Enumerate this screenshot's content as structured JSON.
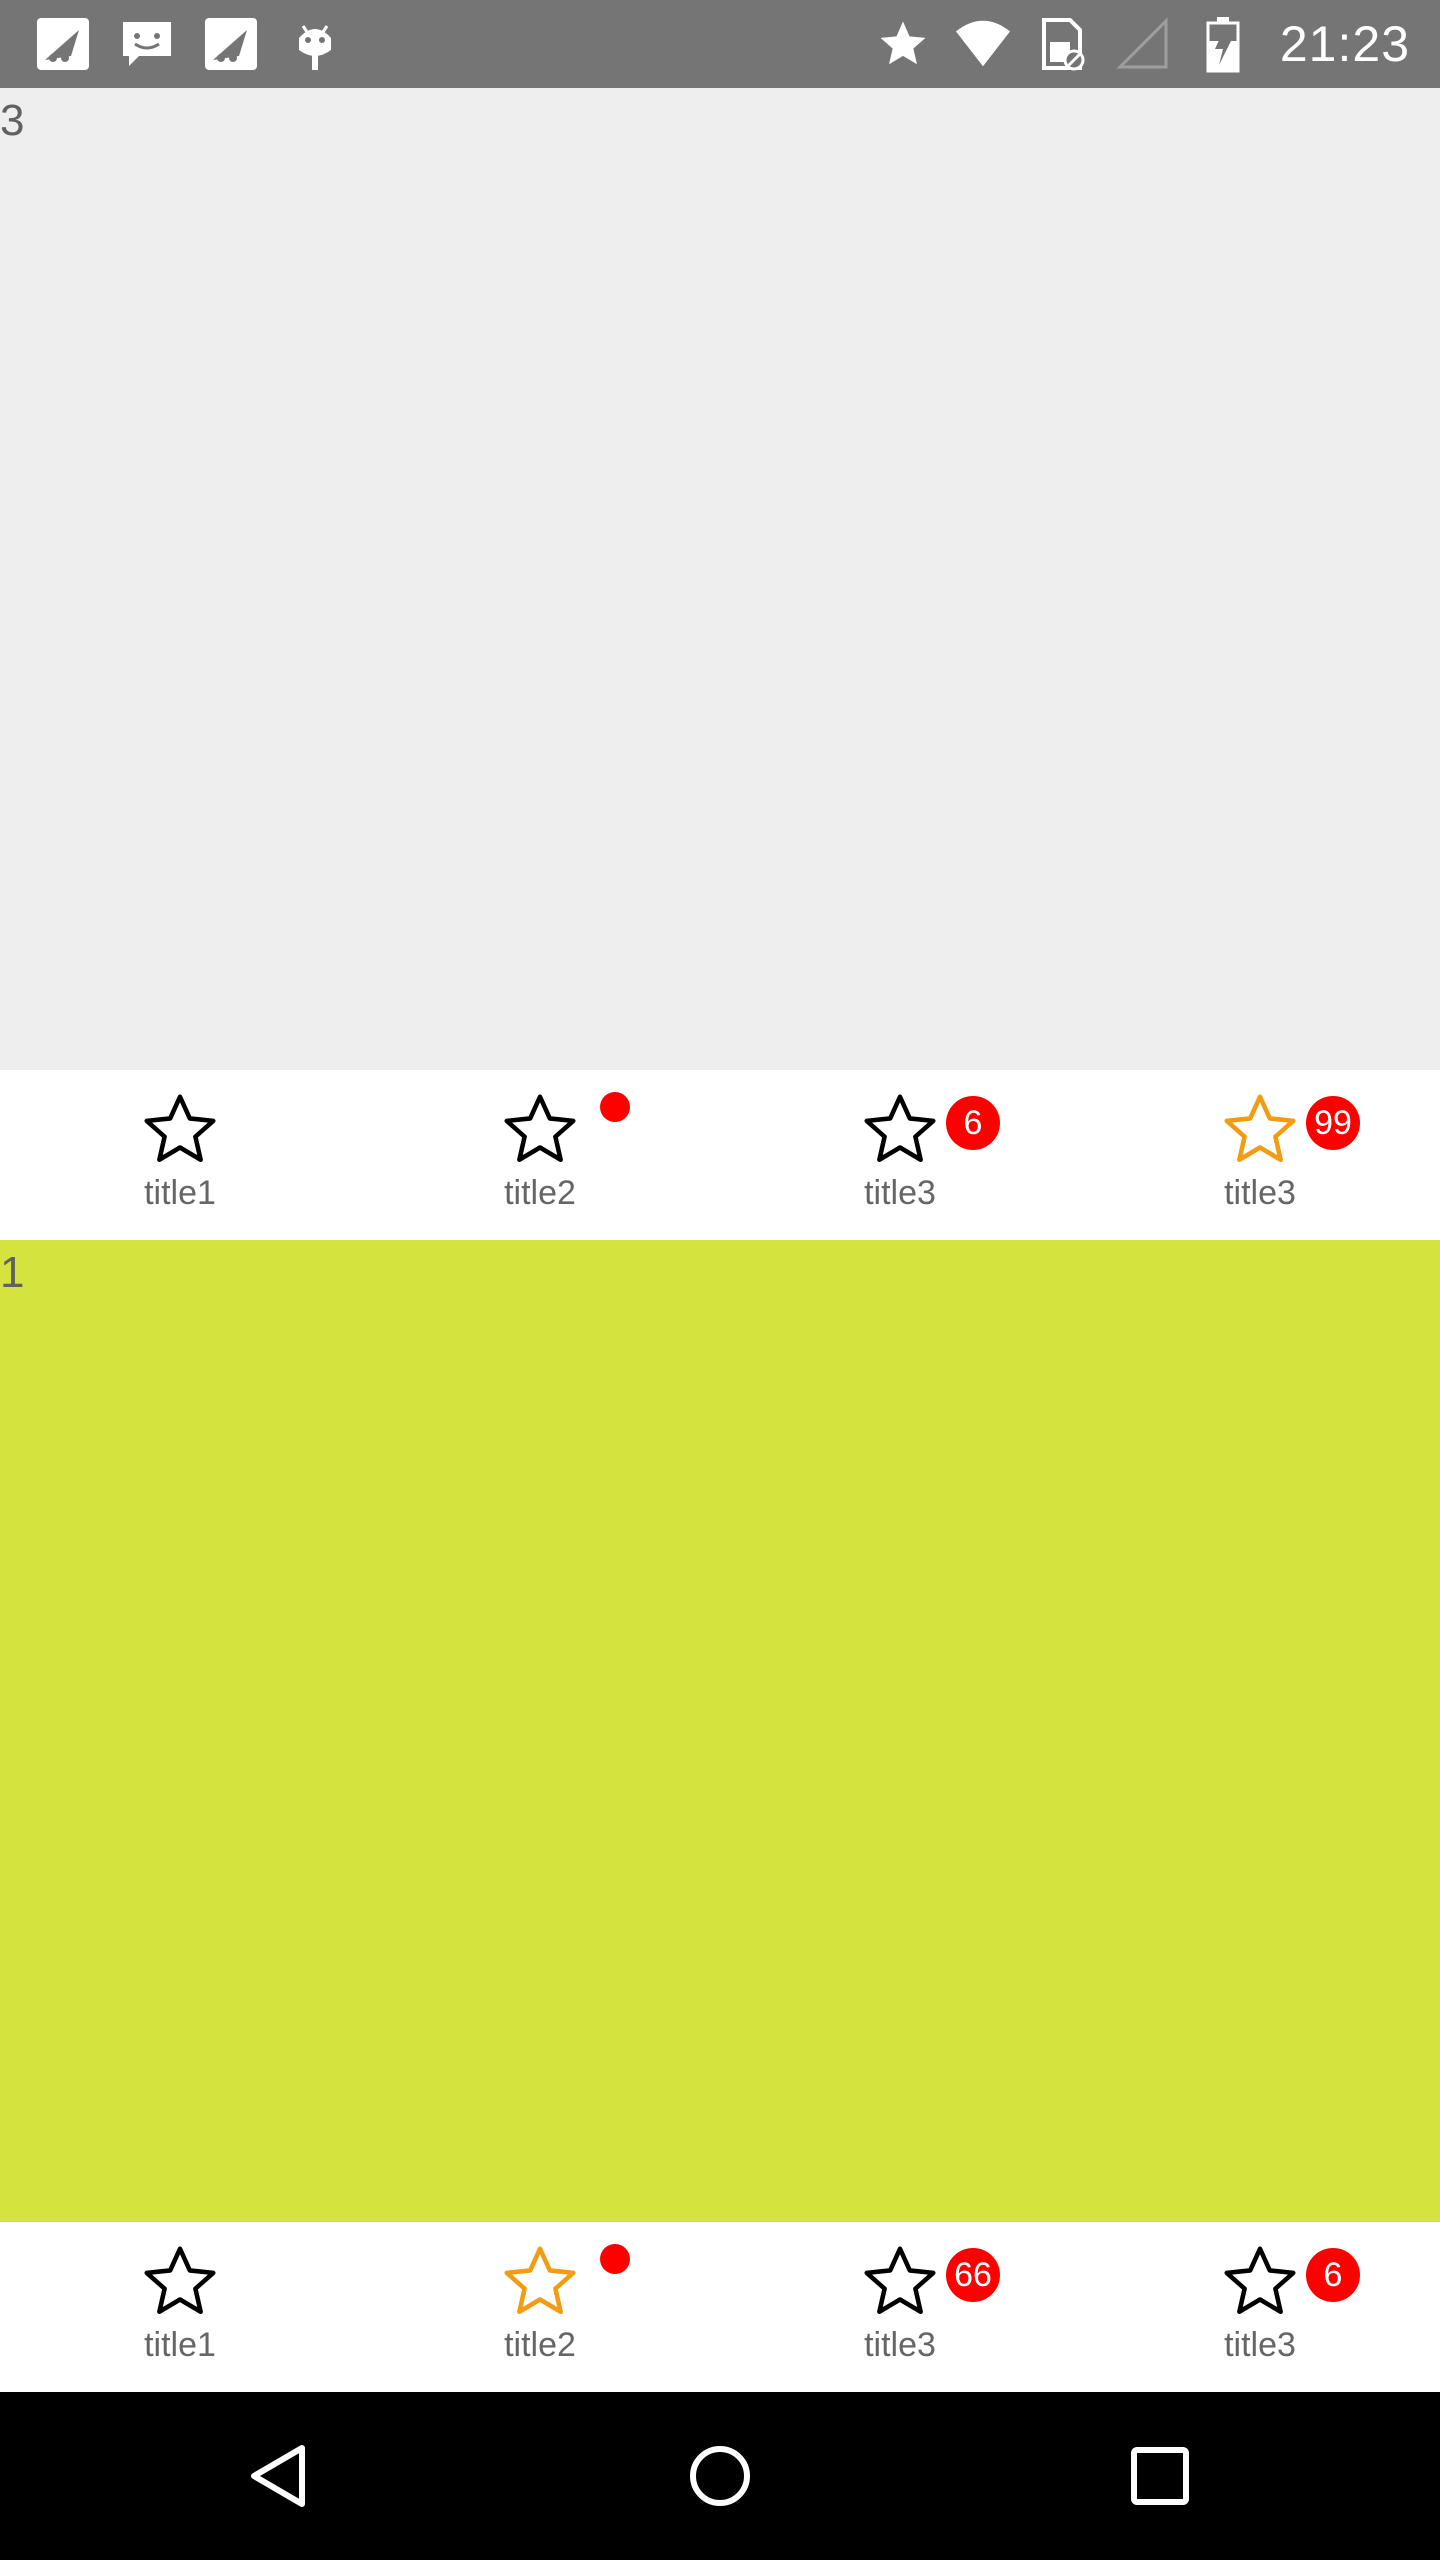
{
  "status_bar": {
    "time": "21:23",
    "left_icons": [
      "bird-notification-icon",
      "message-notification-icon",
      "bird-notification-icon",
      "android-debug-icon"
    ],
    "right_icons": [
      "star-icon",
      "wifi-icon",
      "no-sim-icon",
      "signal-icon",
      "battery-charging-icon"
    ]
  },
  "section1": {
    "label": "3",
    "background": "#eeeeee",
    "tabs": [
      {
        "label": "title1",
        "active": false,
        "badge_type": "none",
        "badge": ""
      },
      {
        "label": "title2",
        "active": false,
        "badge_type": "dot",
        "badge": ""
      },
      {
        "label": "title3",
        "active": false,
        "badge_type": "number",
        "badge": "6"
      },
      {
        "label": "title3",
        "active": true,
        "badge_type": "number",
        "badge": "99"
      }
    ]
  },
  "section2": {
    "label": "1",
    "background": "#d4e33e",
    "tabs": [
      {
        "label": "title1",
        "active": false,
        "badge_type": "none",
        "badge": ""
      },
      {
        "label": "title2",
        "active": true,
        "badge_type": "dot",
        "badge": ""
      },
      {
        "label": "title3",
        "active": false,
        "badge_type": "number",
        "badge": "66"
      },
      {
        "label": "title3",
        "active": false,
        "badge_type": "number",
        "badge": "6"
      }
    ]
  },
  "colors": {
    "active_icon": "#f39c12",
    "inactive_icon": "#000000",
    "badge": "#ff0000",
    "status_bar": "#757575",
    "nav_bar": "#000000"
  },
  "nav_bar": {
    "buttons": [
      "back-icon",
      "home-icon",
      "recents-icon"
    ]
  }
}
